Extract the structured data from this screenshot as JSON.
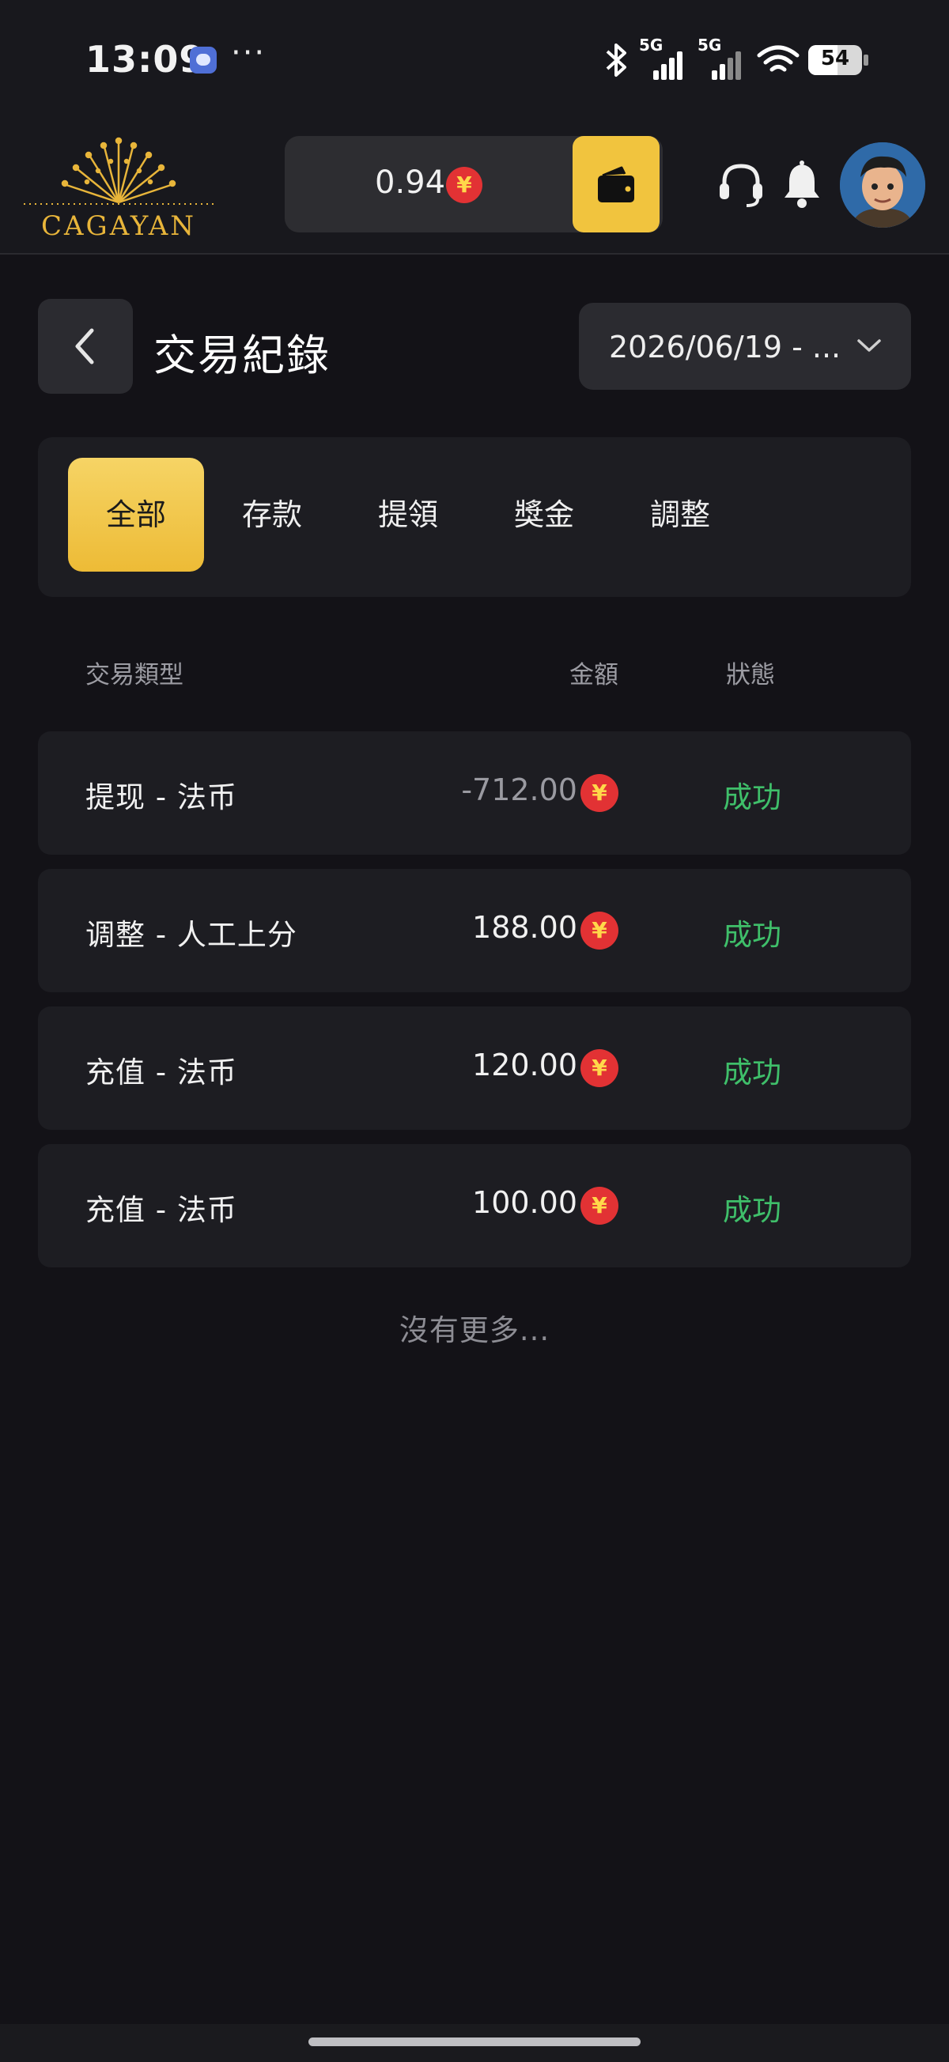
{
  "status_bar": {
    "time": "13:09",
    "more": "···",
    "network_1": "5G",
    "network_2": "5G",
    "battery": "54"
  },
  "header": {
    "logo_text": "CAGAYAN",
    "balance": "0.94",
    "currency_symbol": "¥",
    "icons": [
      "wallet-icon",
      "headset-icon",
      "bell-icon",
      "avatar"
    ]
  },
  "page": {
    "title": "交易紀錄",
    "date_range": "2026/06/19 - ..."
  },
  "tabs": [
    {
      "label": "全部",
      "active": true
    },
    {
      "label": "存款",
      "active": false
    },
    {
      "label": "提領",
      "active": false
    },
    {
      "label": "獎金",
      "active": false
    },
    {
      "label": "調整",
      "active": false
    }
  ],
  "table": {
    "columns": {
      "type": "交易類型",
      "amount": "金額",
      "status": "狀態"
    },
    "rows": [
      {
        "type": "提现 - 法币",
        "amount": "-712.00",
        "status": "成功"
      },
      {
        "type": "调整 - 人工上分",
        "amount": "188.00",
        "status": "成功"
      },
      {
        "type": "充值 - 法币",
        "amount": "120.00",
        "status": "成功"
      },
      {
        "type": "充值 - 法币",
        "amount": "100.00",
        "status": "成功"
      }
    ],
    "footer": "沒有更多..."
  },
  "colors": {
    "background": "#131217",
    "accent_gold": "#f1c43e",
    "success_green": "#3fbf6a",
    "coin_red": "#e23234"
  }
}
